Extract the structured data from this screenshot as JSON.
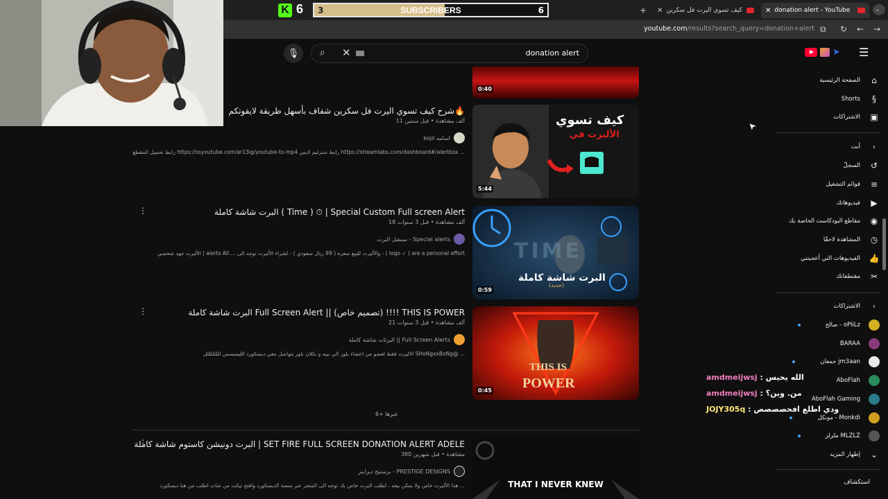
{
  "browser": {
    "tabs": [
      {
        "title": "donation alert - YouTube",
        "active": true
      },
      {
        "title": "شرح كيف تسوي اليرت فل سكرين...",
        "active": false
      }
    ],
    "url_host": "youtube.com",
    "url_rest": "/results?search_query=donation+alert"
  },
  "subs_widget": {
    "platform_logo": "K",
    "count": "6",
    "bar_min": "3",
    "bar_label": "SUBSCRIBERS",
    "bar_max": "6",
    "progress": 0.56
  },
  "search": {
    "query": "donation alert"
  },
  "results": [
    {
      "title": "شرح كيف تسوي اليرت فل سكرين شفاف بأسهل طريقة لايفوتكم🔥",
      "meta": "11 ألف مشاهدة • قبل سنتين",
      "channel": "kojii اسامه",
      "description": "رابط تحميل المقطع https://ssyoutube.com/ar13ig/youtube-to-mp4 رابط سترليم لابس https://streamlabs.com/dashboard#/alertbox ...",
      "duration": "5:44",
      "thumb_text_top": "كيف تسوي",
      "thumb_text_bottom": "الأليرت في",
      "colors": {
        "avatar": "#d8d8c8"
      }
    },
    {
      "title": "البرت شاشة كاملة ( Time ) ⏱ | Special Custom Full screen Alert",
      "meta": "18 ألف مشاهدة • قبل 3 سنوات",
      "channel": "سبشل اليرت - Special alerts",
      "description": "الأليرت جهد شخصي | alerts All ... والأليرت للبيع سعره ( 99 ريال سعودي ) - لشراء الأليرت توجه الى - ( logo ✓ ) are a personal effort",
      "duration": "0:59",
      "thumb_text_top": "TIME",
      "thumb_text_bottom": "البرت شاشة كاملة",
      "thumb_text_tag": "(جديد)",
      "colors": {
        "avatar": "#6b5ca5"
      }
    },
    {
      "title": "البرت شاشة كاملة Full Screen Alert || (تصميم خاص) !!!! THIS IS POWER",
      "meta": "21 ألف مشاهدة • قبل 3 سنوات",
      "channel": "البرتات شاشة كاملة || Full Screen Alerts",
      "description": "الاليرت فقط لعضو من اعضاء بلور الي بيبه و بكلان بلور بتواصل معي ديسكورد الليسسس للللللللل SHoNgxxBoNg@ ...",
      "duration": "0:45",
      "thumb_text_top": "THIS IS",
      "thumb_text_bottom": "POWER",
      "colors": {
        "avatar": "#f0a030"
      }
    },
    {
      "title": "البرت دونيشن كاستوم شاشة كاملة | SET FIRE FULL SCREEN DONATION ALERT ADELE",
      "meta": "380 مشاهدة • قبل شهرين",
      "channel": "برستيج ديزاينز - PRESTIGE DESIGNS",
      "description": "هذا الأليرت خاص ولا يمكن بيعه ، لطلب البرت خاص بك توجه الى المتجر عبر منصة الديسكورد وافتح تيكت من شات اطلب من هنا ديسكورد ...",
      "duration": "",
      "thumb_text_top": "THAT I NEVER KNEW",
      "colors": {
        "avatar": "#222222"
      }
    }
  ],
  "first_partial_duration": "0:40",
  "more_label": "6+ غيرها",
  "sidebar": {
    "items": [
      {
        "label": "الصفحة الرئيسية",
        "icon": "home-icon"
      },
      {
        "label": "Shorts",
        "icon": "shorts-icon"
      },
      {
        "label": "الاشتراكات",
        "icon": "subscriptions-icon"
      }
    ],
    "you_header": "أنت",
    "you_items": [
      {
        "label": "السجلّ",
        "icon": "history-icon"
      },
      {
        "label": "قوائم التشغيل",
        "icon": "playlists-icon"
      },
      {
        "label": "فيديوهاتك",
        "icon": "your-videos-icon"
      },
      {
        "label": "مقاطع البودكاست الخاصة بك",
        "icon": "podcast-icon"
      },
      {
        "label": "المشاهدة لاحقًا",
        "icon": "watch-later-icon"
      },
      {
        "label": "الفيديوهات التي أعجبتني",
        "icon": "liked-icon"
      },
      {
        "label": "مقتطفاتك",
        "icon": "clips-icon"
      }
    ],
    "subs_header": "الاشتراكات",
    "subscriptions": [
      {
        "name": "صالح - oPiiLz",
        "dot": true,
        "color": "#d4b020"
      },
      {
        "name": "BARAA",
        "dot": false,
        "color": "#8a3a7a"
      },
      {
        "name": "جمعان jm3aan",
        "dot": true,
        "color": "#e8e8e8"
      },
      {
        "name": "AboFlah",
        "dot": false,
        "color": "#2a8a5a"
      },
      {
        "name": "AboFlah Gaming",
        "dot": false,
        "color": "#2a7a8a"
      },
      {
        "name": "مونكل - Monkdi",
        "dot": true,
        "color": "#d0a020"
      },
      {
        "name": "ملزلز MLZLZ",
        "dot": true,
        "color": "#555555"
      }
    ],
    "show_more": "إظهار المزيد",
    "explore": "استكشاف"
  },
  "chat": [
    {
      "user": "amdmeijwsj",
      "msg": "الله يحيس"
    },
    {
      "user": "amdmeijwsj",
      "msg": "من. وين؟"
    },
    {
      "user": "JOJY305q",
      "msg": "ودي اطلع افحصصصص"
    }
  ]
}
